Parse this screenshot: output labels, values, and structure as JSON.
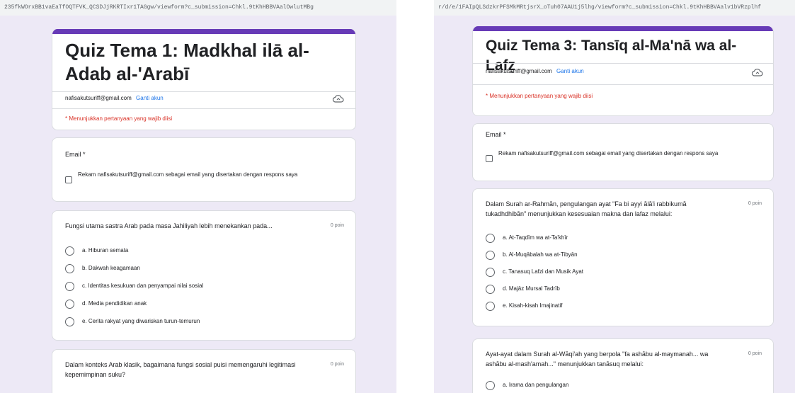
{
  "left": {
    "url_text": "235fkWOrxBB1vaEaTfOQTFVK_QCSDJjRKRTIxr1TAGgw/viewform?c_submission=Chkl.9tKhHBBVAalOwlutMBg",
    "title": "Quiz Tema 1: Madkhal ilā al-Adab al-'Arabī",
    "email": "nafisakutsuriff@gmail.com",
    "switch_account": "Ganti akun",
    "required_note": "* Menunjukkan pertanyaan yang wajib diisi",
    "email_label": "Email *",
    "record_email_text": "Rekam nafisakutsuriff@gmail.com sebagai email yang disertakan dengan respons saya",
    "q1": {
      "text": "Fungsi utama sastra Arab pada masa Jahiliyah lebih menekankan pada...",
      "points": "0 poin",
      "options": [
        "a. Hiburan semata",
        "b. Dakwah keagamaan",
        "c. Identitas kesukuan dan penyampai nilai sosial",
        "d. Media pendidikan anak",
        "e. Cerita rakyat yang diwariskan turun-temurun"
      ]
    },
    "q2": {
      "text": "Dalam konteks Arab klasik, bagaimana fungsi sosial puisi memengaruhi legitimasi kepemimpinan suku?",
      "points": "0 poin"
    }
  },
  "right": {
    "url_text": "r/d/e/1FAIpQLSdzkrPFSMkMRtjsrX_oTuh07AAU1j5lhg/viewform?c_submission=Chkl.9tKhHBBVAalv1bVRzplhf",
    "title": "Quiz  Tema 3: Tansīq al-Ma'nā wa al-Lafẓ",
    "email": "nafisakutsuriff@gmail.com",
    "switch_account": "Ganti akun",
    "required_note": "* Menunjukkan pertanyaan yang wajib diisi",
    "email_label": "Email *",
    "record_email_text": "Rekam nafisakutsuriff@gmail.com sebagai email yang disertakan dengan respons saya",
    "q1": {
      "text": "Dalam Surah ar-Rahmān, pengulangan ayat \"Fa bi ayyi ālā'i rabbikumā tukadhdhibān\" menunjukkan kesesuaian makna dan lafaz melalui:",
      "points": "0 poin",
      "options": [
        "a. At-Taqdīm wa at-Ta'khīr",
        "b. Al-Muqābalah wa at-Tibyān",
        "c. Tanasuq Lafzi dan Musik Ayat",
        "d. Majāz Mursal Tadrīb",
        "e. Kisah-kisah Imajinatif"
      ]
    },
    "q2": {
      "text": "Ayat-ayat dalam Surah al-Wāqi'ah yang berpola \"fa ashābu al-maymanah... wa ashābu al-mash'amah...\" menunjukkan tanāsuq melalui:",
      "points": "0 poin",
      "first_option": "a. Irama dan pengulangan"
    }
  }
}
